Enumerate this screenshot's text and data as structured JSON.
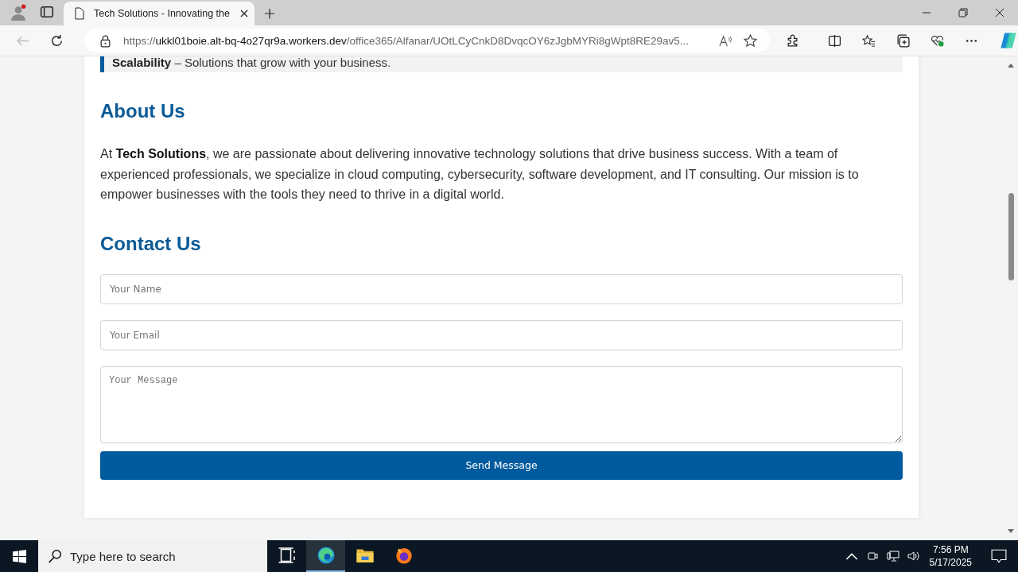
{
  "browser": {
    "tabs": [
      {
        "title": "Tech Solutions - Innovating the",
        "selected": true
      }
    ],
    "address": {
      "scheme": "https://",
      "host": "ukkl01boie.alt-bq-4o27qr9a.workers.dev",
      "path": "/office365/Alfanar/UOtLCyCnkD8DvqcOY6zJgbMYRi8gWpt8RE29av5..."
    }
  },
  "page": {
    "feature": {
      "term": "Scalability",
      "text": "– Solutions that grow with your business."
    },
    "about": {
      "heading": "About Us",
      "paragraph": "At **Tech Solutions**, we are passionate about delivering innovative technology solutions that drive business success. With a team of experienced professionals, we specialize in cloud computing, cybersecurity, software development, and IT consulting. Our mission is to empower businesses with the tools they need to thrive in a digital world."
    },
    "contact": {
      "heading": "Contact Us",
      "fields": [
        {
          "kind": "input",
          "placeholder": "Your Name"
        },
        {
          "kind": "input",
          "placeholder": "Your Email"
        },
        {
          "kind": "textarea",
          "placeholder": "Your Message"
        }
      ],
      "button": "Send Message"
    }
  },
  "taskbar": {
    "search": {
      "placeholder": "Type here to search"
    },
    "apps": [
      {
        "kind": "taskview",
        "selected": false
      },
      {
        "kind": "edge",
        "selected": true
      },
      {
        "kind": "files",
        "selected": false
      },
      {
        "kind": "firefox",
        "selected": false
      }
    ],
    "time": "7:56 PM",
    "date": "5/17/2025"
  }
}
